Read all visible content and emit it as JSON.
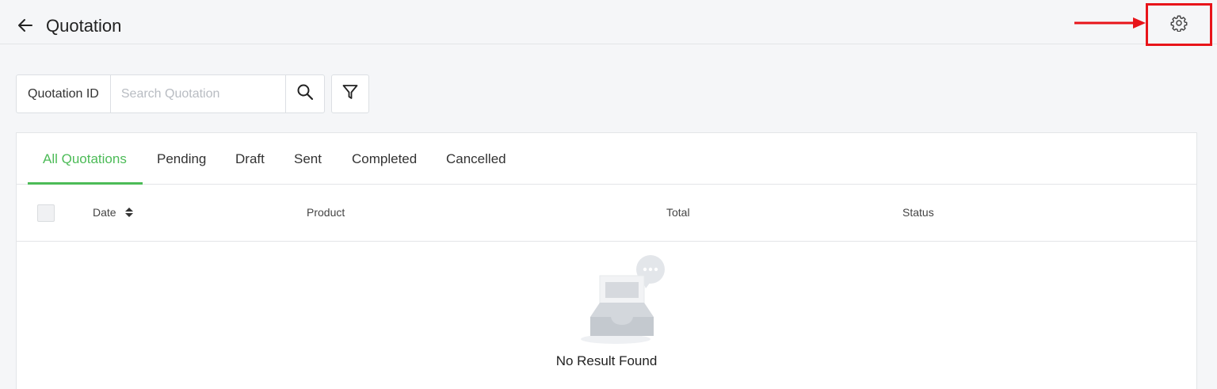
{
  "header": {
    "title": "Quotation",
    "back_icon": "arrow-left-icon",
    "settings_icon": "gear-icon",
    "annotation_color": "#e8141a"
  },
  "search": {
    "type_label": "Quotation ID",
    "placeholder": "Search Quotation",
    "value": "",
    "search_icon": "search-icon",
    "filter_icon": "filter-icon"
  },
  "tabs": [
    {
      "label": "All Quotations",
      "active": true
    },
    {
      "label": "Pending",
      "active": false
    },
    {
      "label": "Draft",
      "active": false
    },
    {
      "label": "Sent",
      "active": false
    },
    {
      "label": "Completed",
      "active": false
    },
    {
      "label": "Cancelled",
      "active": false
    }
  ],
  "table": {
    "columns": [
      "Date",
      "Product",
      "Total",
      "Status"
    ],
    "rows": []
  },
  "empty_state": {
    "message": "No Result Found",
    "illustration": "empty-inbox-icon"
  },
  "colors": {
    "accent": "#4cbb57",
    "background": "#f5f6f8"
  }
}
